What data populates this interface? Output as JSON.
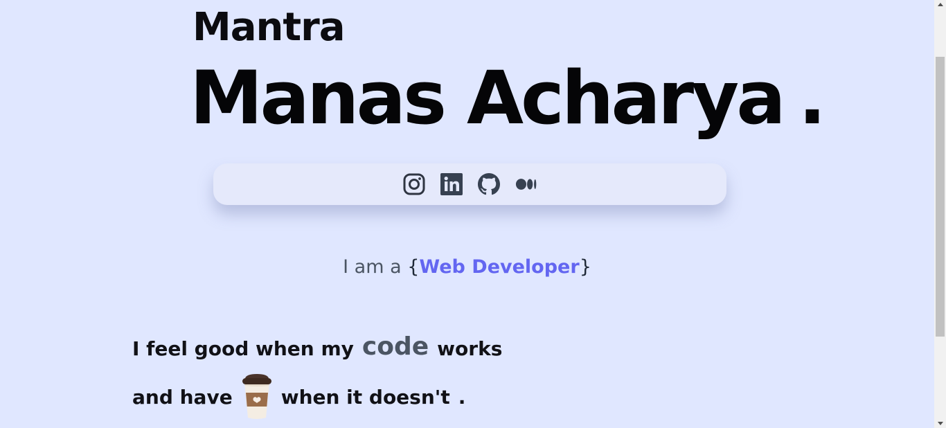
{
  "brand": "Mantra",
  "hero": {
    "name": "Manas Acharya",
    "dot": "."
  },
  "social": [
    {
      "name": "instagram-icon"
    },
    {
      "name": "linkedin-icon"
    },
    {
      "name": "github-icon"
    },
    {
      "name": "medium-icon"
    }
  ],
  "tagline": {
    "prefix": "I am a ",
    "open_brace": "{",
    "role": "Web Developer",
    "close_brace": "}"
  },
  "motto": {
    "line1_before": "I feel good when my",
    "line1_code": "code",
    "line1_after": "works",
    "line2_before": "and have",
    "line2_icon": "coffee-cup-icon",
    "line2_after": "when it doesn't",
    "end_dot": "."
  },
  "colors": {
    "background": "#e0e7ff",
    "accent": "#6366f1",
    "icon": "#374151",
    "text": "#050507"
  }
}
